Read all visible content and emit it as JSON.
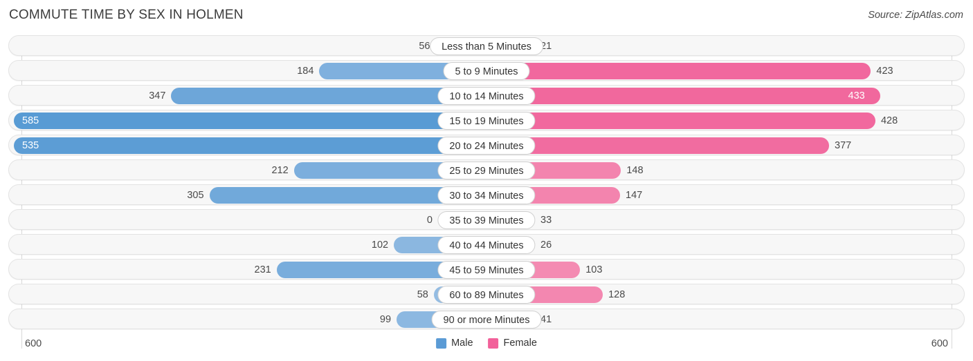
{
  "header": {
    "title": "COMMUTE TIME BY SEX IN HOLMEN",
    "source": "Source: ZipAtlas.com"
  },
  "axis": {
    "left_label": "600",
    "right_label": "600"
  },
  "legend": {
    "items": [
      {
        "label": "Male",
        "color": "#5b9bd5"
      },
      {
        "label": "Female",
        "color": "#f2619a"
      }
    ]
  },
  "chart_data": {
    "type": "bar",
    "orientation": "horizontal",
    "layout": "diverging-bidirectional",
    "title": "COMMUTE TIME BY SEX IN HOLMEN",
    "xlabel": "",
    "ylabel": "",
    "xlim": [
      -600,
      600
    ],
    "axis_max": 600,
    "grid": true,
    "legend_position": "bottom-center",
    "categories": [
      "Less than 5 Minutes",
      "5 to 9 Minutes",
      "10 to 14 Minutes",
      "15 to 19 Minutes",
      "20 to 24 Minutes",
      "25 to 29 Minutes",
      "30 to 34 Minutes",
      "35 to 39 Minutes",
      "40 to 44 Minutes",
      "45 to 59 Minutes",
      "60 to 89 Minutes",
      "90 or more Minutes"
    ],
    "series": [
      {
        "name": "Male",
        "color": "#5b9bd5",
        "direction": "left",
        "values": [
          56,
          184,
          347,
          585,
          535,
          212,
          305,
          0,
          102,
          231,
          58,
          99
        ]
      },
      {
        "name": "Female",
        "color": "#f2619a",
        "direction": "right",
        "values": [
          21,
          423,
          433,
          428,
          377,
          148,
          147,
          33,
          26,
          103,
          128,
          41
        ]
      }
    ]
  }
}
